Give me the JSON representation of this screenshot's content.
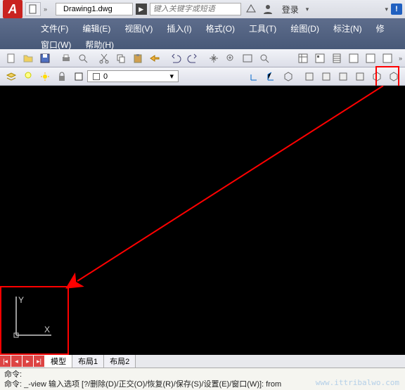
{
  "title": {
    "filename": "Drawing1.dwg"
  },
  "search": {
    "placeholder": "键入关键字或短语"
  },
  "login": {
    "label": "登录"
  },
  "menu": {
    "file": "文件(F)",
    "edit": "编辑(E)",
    "view": "视图(V)",
    "insert": "插入(I)",
    "format": "格式(O)",
    "tools": "工具(T)",
    "draw": "绘图(D)",
    "annotate": "标注(N)",
    "modify": "修",
    "window": "窗口(W)",
    "help": "帮助(H)"
  },
  "layer": {
    "current": "0"
  },
  "layout": {
    "model": "模型",
    "tab1": "布局1",
    "tab2": "布局2"
  },
  "cmd": {
    "line1": "命令:",
    "line2": "命令: _-view 输入选项 [?/删除(D)/正交(O)/恢复(R)/保存(S)/设置(E)/窗口(W)]:  from"
  },
  "ucs": {
    "x": "X",
    "y": "Y"
  },
  "watermark": "www.ittribalwo.com"
}
